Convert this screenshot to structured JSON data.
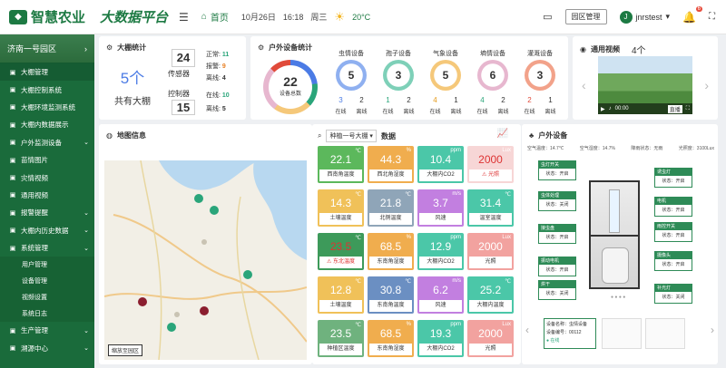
{
  "header": {
    "logo": "智慧农业",
    "brand": "大数据平台",
    "home": "首页",
    "date": "10月26日",
    "time": "16:18",
    "weekday": "周三",
    "temp": "20°C",
    "park_btn": "园区管理",
    "user": "jnrstest",
    "notice_count": "6"
  },
  "sidebar": {
    "park": "济南一号园区",
    "items": [
      {
        "label": "大棚管理",
        "active": true
      },
      {
        "label": "大棚控制系统"
      },
      {
        "label": "大棚环境监测系统"
      },
      {
        "label": "大棚内数据展示"
      },
      {
        "label": "户外监测设备",
        "arrow": true
      },
      {
        "label": "苗情图片"
      },
      {
        "label": "灾情视频"
      },
      {
        "label": "通用视频"
      },
      {
        "label": "报警提醒",
        "arrow": true
      },
      {
        "label": "大棚内历史数据",
        "arrow": true
      },
      {
        "label": "系统管理",
        "arrow": true
      }
    ],
    "subs": [
      "用户管理",
      "设备管理",
      "视频设置",
      "系统日志"
    ],
    "after": [
      {
        "label": "生产管理",
        "arrow": true
      },
      {
        "label": "溯源中心",
        "arrow": true
      }
    ]
  },
  "greenhouse": {
    "title": "大棚统计",
    "count": "5个",
    "count_label": "共有大棚",
    "sensor_num": "24",
    "sensor_label": "传感器",
    "ctrl_num": "15",
    "ctrl_label": "控制器",
    "s_normal_l": "正常:",
    "s_normal": "11",
    "s_alarm_l": "报警:",
    "s_alarm": "9",
    "s_off_l": "离线:",
    "s_off": "4",
    "c_on_l": "在线:",
    "c_on": "10",
    "c_off_l": "离线:",
    "c_off": "5"
  },
  "outdoor": {
    "title": "户外设备统计",
    "total": "22",
    "total_label": "设备总数",
    "online": "在线",
    "offline": "离线",
    "devices": [
      {
        "name": "虫情设备",
        "count": "5",
        "on": "3",
        "off": "2",
        "color": "#8fb0f0",
        "on_color": "#4b7be5"
      },
      {
        "name": "孢子设备",
        "count": "3",
        "on": "1",
        "off": "2",
        "color": "#7ed0b8",
        "on_color": "#2aa57a"
      },
      {
        "name": "气象设备",
        "count": "5",
        "on": "4",
        "off": "1",
        "color": "#f5c87a",
        "on_color": "#e59a1a"
      },
      {
        "name": "墒情设备",
        "count": "6",
        "on": "4",
        "off": "2",
        "color": "#e7b7cf",
        "on_color": "#2aa57a"
      },
      {
        "name": "灌溉设备",
        "count": "3",
        "on": "2",
        "off": "1",
        "color": "#f2a28a",
        "on_color": "#e04a3a"
      }
    ]
  },
  "video": {
    "title": "通用视频",
    "count": "4个",
    "time": "00:00",
    "tag": "直播"
  },
  "map": {
    "title": "地图信息",
    "btn": "缩放至园区"
  },
  "env": {
    "select": "种植一号大棚",
    "title": "数据",
    "tiles": [
      {
        "v": "22.1",
        "u": "℃",
        "l": "西南角温度",
        "c": "#5cb85c"
      },
      {
        "v": "44.3",
        "u": "%",
        "l": "西北角湿度",
        "c": "#f0ad4e"
      },
      {
        "v": "10.4",
        "u": "ppm",
        "l": "大棚内CO2",
        "c": "#4bc7a8"
      },
      {
        "v": "2000",
        "u": "Lux",
        "l": "光照",
        "c": "#f7d6d6",
        "alarm": true,
        "vc": "#d33"
      },
      {
        "v": "14.3",
        "u": "℃",
        "l": "土壤温度",
        "c": "#f0c159"
      },
      {
        "v": "21.8",
        "u": "℃",
        "l": "北侧温度",
        "c": "#8fa5b8"
      },
      {
        "v": "3.7",
        "u": "m/s",
        "l": "风速",
        "c": "#c27fe0"
      },
      {
        "v": "31.4",
        "u": "℃",
        "l": "温室温度",
        "c": "#4bc7a8"
      },
      {
        "v": "23.5",
        "u": "℃",
        "l": "东北温度",
        "c": "#3d9a5a",
        "alarm": true,
        "vc": "#d33"
      },
      {
        "v": "68.5",
        "u": "%",
        "l": "东南角湿度",
        "c": "#f0ad4e"
      },
      {
        "v": "12.9",
        "u": "ppm",
        "l": "大棚内CO2",
        "c": "#4bc7a8"
      },
      {
        "v": "2000",
        "u": "Lux",
        "l": "光照",
        "c": "#f2a29f"
      },
      {
        "v": "12.8",
        "u": "℃",
        "l": "土壤温度",
        "c": "#f0c159"
      },
      {
        "v": "30.8",
        "u": "℃",
        "l": "东南角温度",
        "c": "#6b8fc2"
      },
      {
        "v": "6.2",
        "u": "m/s",
        "l": "风速",
        "c": "#c27fe0"
      },
      {
        "v": "25.2",
        "u": "℃",
        "l": "大棚内温度",
        "c": "#4bc7a8"
      },
      {
        "v": "23.5",
        "u": "℃",
        "l": "种植区温度",
        "c": "#6fb27e"
      },
      {
        "v": "68.5",
        "u": "%",
        "l": "东南角湿度",
        "c": "#f0ad4e"
      },
      {
        "v": "19.3",
        "u": "ppm",
        "l": "大棚内CO2",
        "c": "#4bc7a8"
      },
      {
        "v": "2000",
        "u": "Lux",
        "l": "光照",
        "c": "#f2a29f"
      }
    ]
  },
  "device": {
    "title": "户外设备",
    "weather": [
      "空气温度：14.7℃",
      "空气湿度：14.7%",
      "降雨状态：无雨",
      "光照度：3100Lux"
    ],
    "callouts": [
      {
        "h": "虫灯开关",
        "b": "状态：开启"
      },
      {
        "h": "诱虫灯",
        "b": "状态：开启"
      },
      {
        "h": "虫体处理",
        "b": "状态：关闭"
      },
      {
        "h": "电机",
        "b": "状态：开启"
      },
      {
        "h": "接虫盘",
        "b": "状态：开启"
      },
      {
        "h": "雨控开关",
        "b": "状态：开启"
      },
      {
        "h": "振动电机",
        "b": "状态：开启"
      },
      {
        "h": "摄像头",
        "b": "状态：开启"
      },
      {
        "h": "烘干",
        "b": "状态：关闭"
      },
      {
        "h": "补光灯",
        "b": "状态：关闭"
      }
    ],
    "card_title": "设备名称：虫情设备",
    "card_id": "设备编号：00112",
    "card_status": "在线"
  }
}
